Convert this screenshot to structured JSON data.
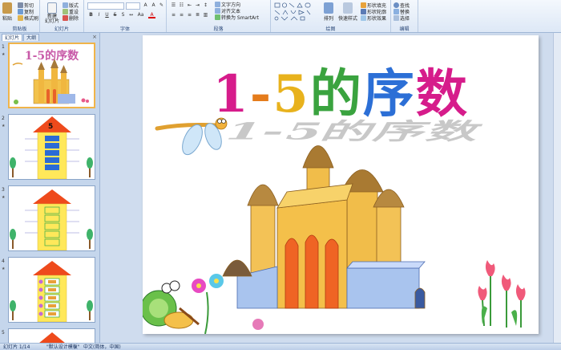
{
  "ribbon": {
    "groups": {
      "clipboard": "剪贴板",
      "slides": "幻灯片",
      "font": "字体",
      "paragraph": "段落",
      "drawing": "绘图",
      "editing": "编辑"
    },
    "clipboard": {
      "paste": "粘贴",
      "cut": "剪切",
      "copy": "复制",
      "format_painter": "格式刷"
    },
    "slides": {
      "new_slide": "新建\n幻灯片",
      "layout": "版式",
      "reset": "重设",
      "delete": "删除"
    },
    "paragraph": {
      "text_direction": "文字方向",
      "align_text": "对齐文本",
      "convert_smartart": "转换为 SmartArt"
    },
    "drawing": {
      "arrange": "排列",
      "quick_styles": "快速样式",
      "shape_fill": "形状填充",
      "shape_outline": "形状轮廓",
      "shape_effects": "形状效果"
    },
    "editing": {
      "find": "查找",
      "replace": "替换",
      "select": "选择"
    }
  },
  "left_panel": {
    "tabs": [
      "幻灯片",
      "大纲"
    ],
    "close": "×",
    "thumbnails": [
      {
        "number": "1",
        "title": "1-5的序数"
      },
      {
        "number": "2",
        "floor_label": "5"
      },
      {
        "number": "3"
      },
      {
        "number": "4"
      },
      {
        "number": "5"
      }
    ]
  },
  "slide": {
    "title": "1-5的序数",
    "title_colors": [
      "#d61c8b",
      "#e57c1c",
      "#e8b21d",
      "#3aa33f",
      "#2c6fd6"
    ]
  },
  "status_bar": {
    "slide_info": "幻灯片 1/14",
    "theme": "\"默认设计模板\"",
    "language": "中文(简体，中国)"
  },
  "colors": {
    "ribbon_bg": "#dde8f6",
    "panel_bg": "#c5d6ec",
    "selection": "#f0b44a",
    "house_roof": "#ee4a1c",
    "house_wall": "#ffe85a"
  }
}
